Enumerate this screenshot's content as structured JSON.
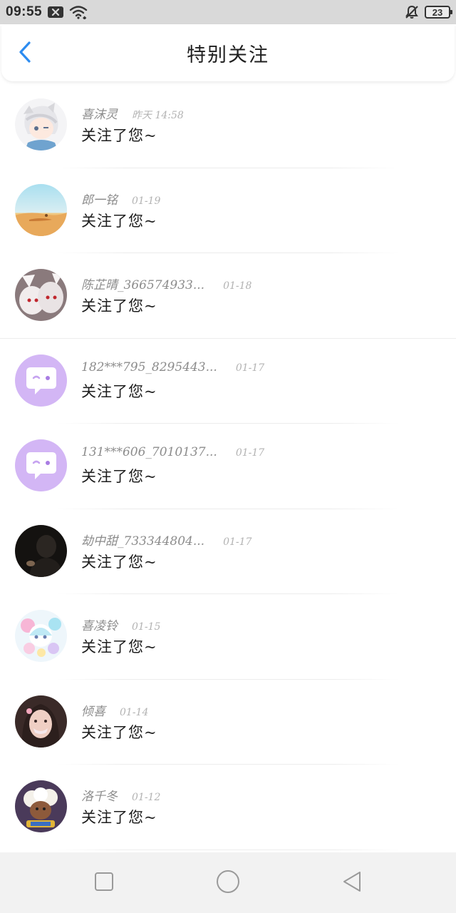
{
  "status_bar": {
    "time": "09:55",
    "battery": "23",
    "icons": [
      "notification-x-icon",
      "wifi-icon",
      "bell-off-icon",
      "battery-icon"
    ]
  },
  "header": {
    "title": "特别关注",
    "back_icon": "chevron-left-icon",
    "accent_color": "#2d8cf0"
  },
  "list": {
    "items": [
      {
        "name": "喜沫灵",
        "time": "昨天 14:58",
        "message": "关注了您~",
        "avatar": "anime-boy-avatar"
      },
      {
        "name": "郎一铭",
        "time": "01-19",
        "message": "关注了您~",
        "avatar": "desert-avatar"
      },
      {
        "name": "陈芷晴_366574933...",
        "time": "01-18",
        "message": "关注了您~",
        "avatar": "anime-girls-avatar"
      },
      {
        "name": "182***795_8295443...",
        "time": "01-17",
        "message": "关注了您~",
        "avatar": "default-chat-avatar"
      },
      {
        "name": "131***606_7010137...",
        "time": "01-17",
        "message": "关注了您~",
        "avatar": "default-chat-avatar"
      },
      {
        "name": "劫中甜_733344804...",
        "time": "01-17",
        "message": "关注了您~",
        "avatar": "dark-photo-avatar"
      },
      {
        "name": "喜凌铃",
        "time": "01-15",
        "message": "关注了您~",
        "avatar": "pastel-cartoon-avatar"
      },
      {
        "name": "倾喜",
        "time": "01-14",
        "message": "关注了您~",
        "avatar": "girl-portrait-avatar"
      },
      {
        "name": "洛千冬",
        "time": "01-12",
        "message": "关注了您~",
        "avatar": "game-sheep-avatar"
      }
    ]
  },
  "nav_bar": {
    "icons": [
      "recent-apps-icon",
      "home-icon",
      "back-triangle-icon"
    ]
  }
}
